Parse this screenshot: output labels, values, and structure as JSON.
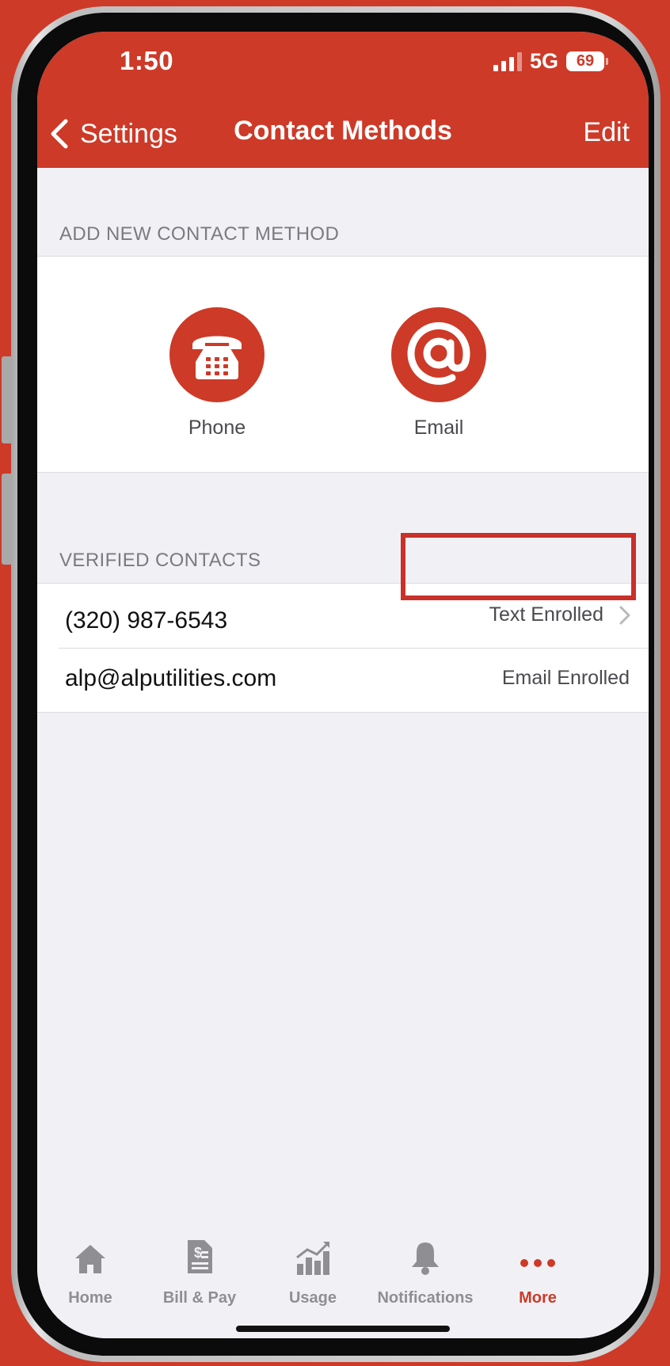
{
  "status_bar": {
    "time": "1:50",
    "network": "5G",
    "battery": "69"
  },
  "nav": {
    "back_label": "Settings",
    "title": "Contact Methods",
    "edit_label": "Edit"
  },
  "add_section": {
    "header": "ADD NEW CONTACT METHOD",
    "methods": [
      {
        "label": "Phone",
        "icon": "telephone-icon"
      },
      {
        "label": "Email",
        "icon": "at-sign-icon"
      }
    ]
  },
  "verified_section": {
    "header": "VERIFIED CONTACTS",
    "contacts": [
      {
        "value": "(320) 987-6543",
        "status": "Text Enrolled",
        "has_chevron": true
      },
      {
        "value": "alp@alputilities.com",
        "status": "Email Enrolled",
        "has_chevron": false
      }
    ]
  },
  "tabbar": {
    "tabs": [
      {
        "label": "Home",
        "icon": "home-icon"
      },
      {
        "label": "Bill & Pay",
        "icon": "bill-icon"
      },
      {
        "label": "Usage",
        "icon": "usage-chart-icon"
      },
      {
        "label": "Notifications",
        "icon": "bell-icon"
      },
      {
        "label": "More",
        "icon": "more-dots-icon",
        "active": true
      }
    ]
  },
  "colors": {
    "brand": "#cd3a28",
    "highlight": "#c9302a",
    "background": "#f1f1f5"
  }
}
